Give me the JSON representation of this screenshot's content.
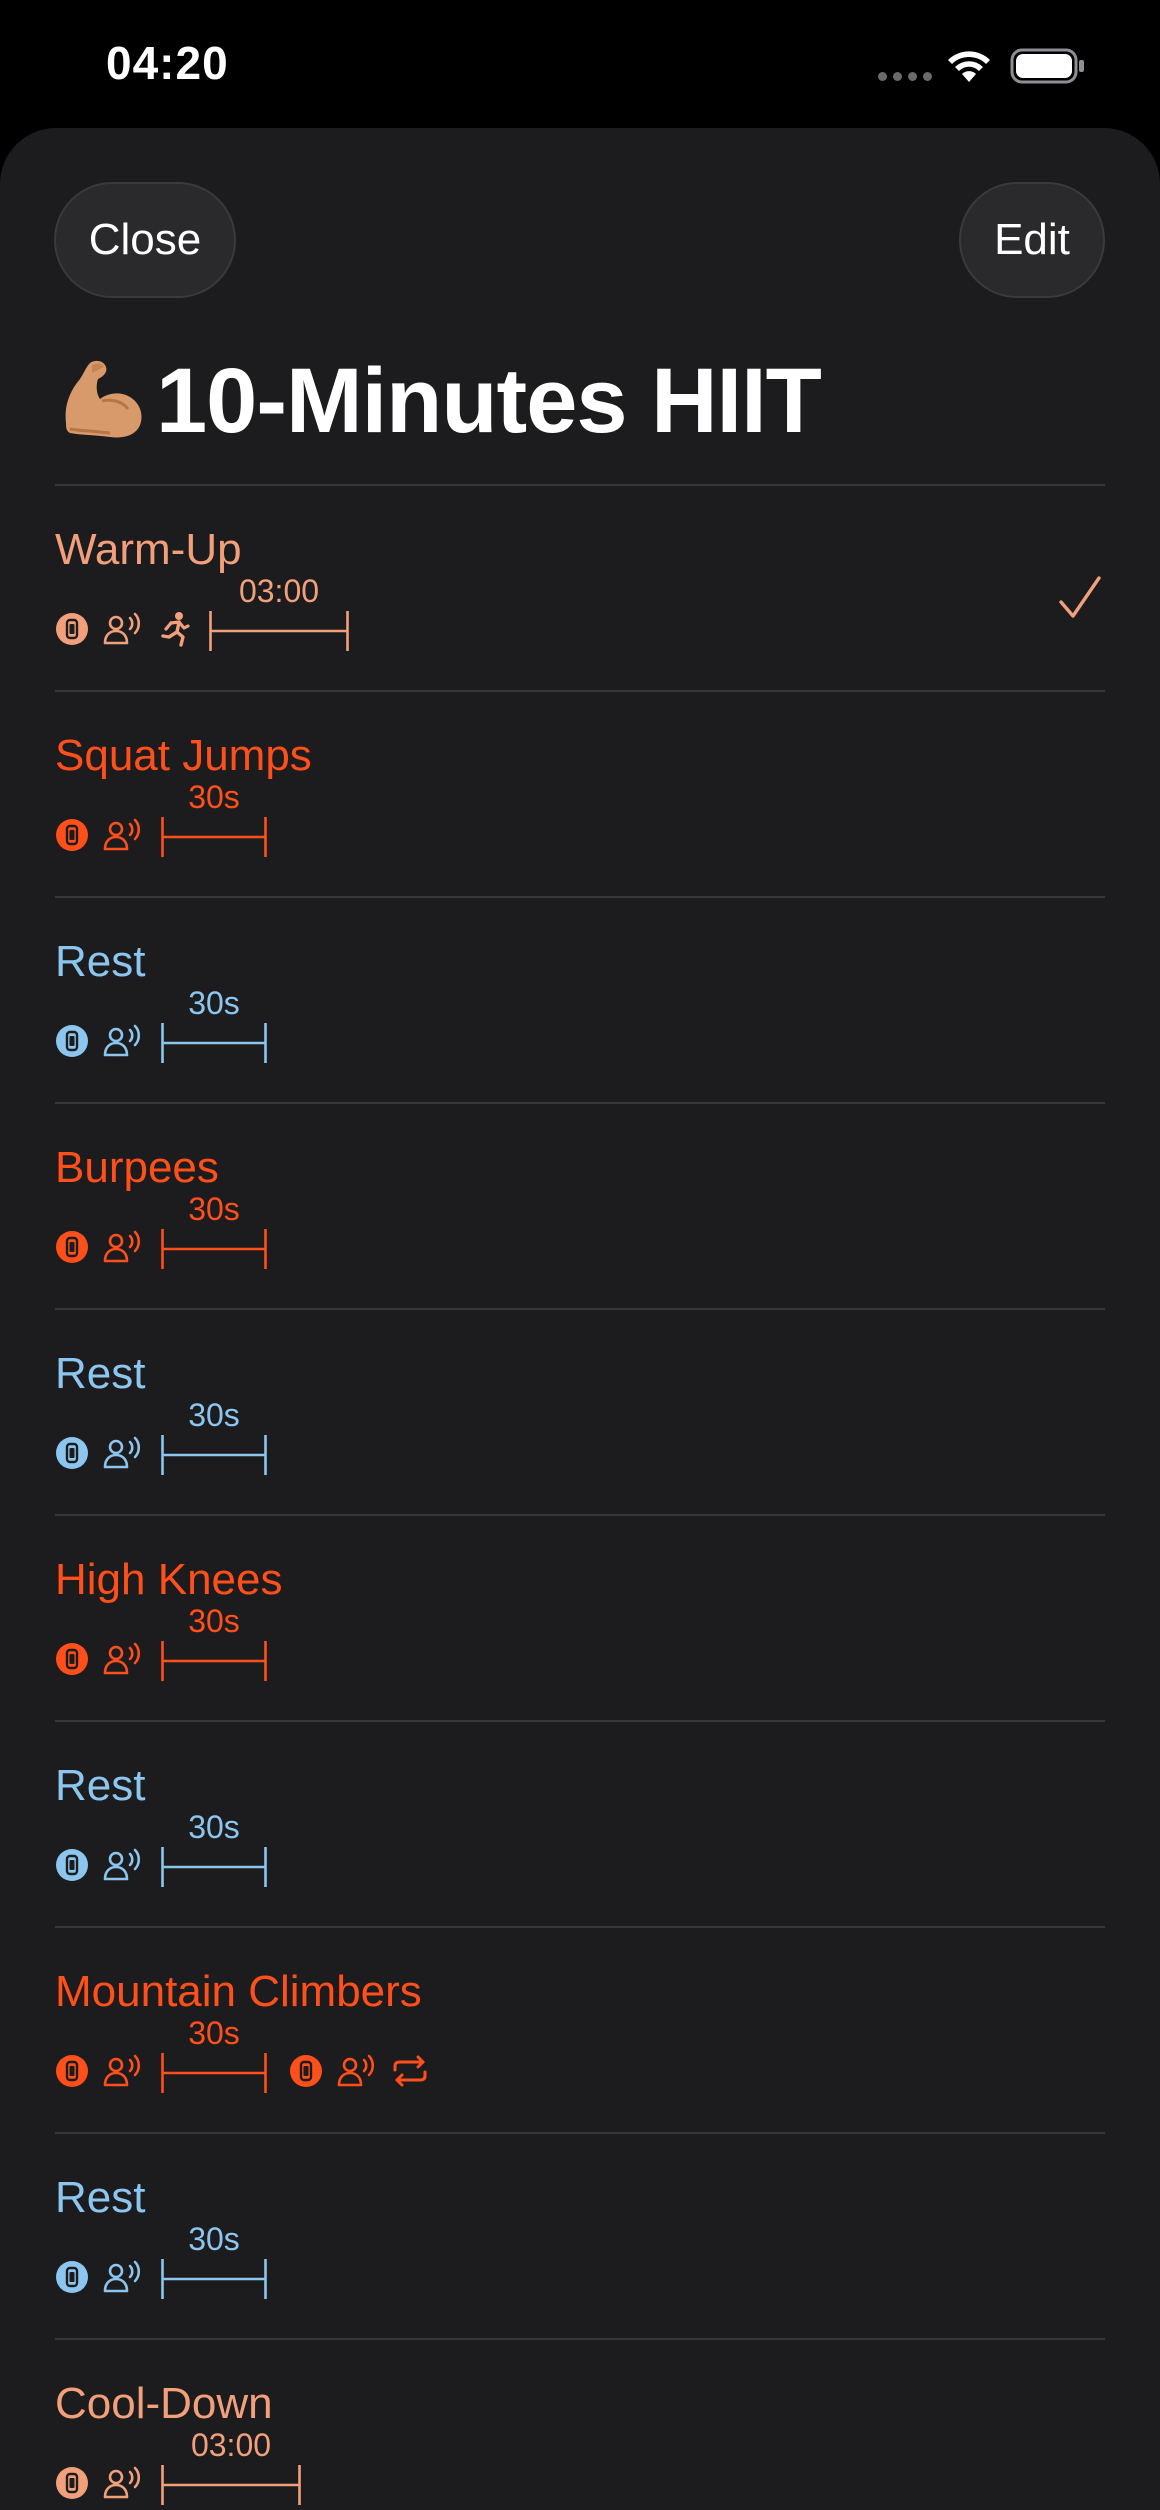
{
  "status_bar": {
    "time": "04:20"
  },
  "header": {
    "close_label": "Close",
    "edit_label": "Edit"
  },
  "workout": {
    "title": "10-Minutes HIIT",
    "title_icon": "flexed-biceps-emoji"
  },
  "colors": {
    "warm": "#f2a07b",
    "active": "#ff4f1a",
    "rest": "#8cc6ef",
    "sheet_bg": "#1c1c1e",
    "divider": "#38383a"
  },
  "intervals": [
    {
      "name": "Warm-Up",
      "duration": "03:00",
      "kind": "warm",
      "icons": [
        "watch-badge-icon",
        "voice-cue-icon",
        "running-figure-icon"
      ],
      "completed": true,
      "repeat": false
    },
    {
      "name": "Squat Jumps",
      "duration": "30s",
      "kind": "active",
      "icons": [
        "watch-badge-icon",
        "voice-cue-icon"
      ],
      "completed": false,
      "repeat": false
    },
    {
      "name": "Rest",
      "duration": "30s",
      "kind": "rest",
      "icons": [
        "watch-badge-icon",
        "voice-cue-icon"
      ],
      "completed": false,
      "repeat": false
    },
    {
      "name": "Burpees",
      "duration": "30s",
      "kind": "active",
      "icons": [
        "watch-badge-icon",
        "voice-cue-icon"
      ],
      "completed": false,
      "repeat": false
    },
    {
      "name": "Rest",
      "duration": "30s",
      "kind": "rest",
      "icons": [
        "watch-badge-icon",
        "voice-cue-icon"
      ],
      "completed": false,
      "repeat": false
    },
    {
      "name": "High Knees",
      "duration": "30s",
      "kind": "active",
      "icons": [
        "watch-badge-icon",
        "voice-cue-icon"
      ],
      "completed": false,
      "repeat": false
    },
    {
      "name": "Rest",
      "duration": "30s",
      "kind": "rest",
      "icons": [
        "watch-badge-icon",
        "voice-cue-icon"
      ],
      "completed": false,
      "repeat": false
    },
    {
      "name": "Mountain Climbers",
      "duration": "30s",
      "kind": "active",
      "icons": [
        "watch-badge-icon",
        "voice-cue-icon"
      ],
      "completed": false,
      "repeat": true
    },
    {
      "name": "Rest",
      "duration": "30s",
      "kind": "rest",
      "icons": [
        "watch-badge-icon",
        "voice-cue-icon"
      ],
      "completed": false,
      "repeat": false
    },
    {
      "name": "Cool-Down",
      "duration": "03:00",
      "kind": "warm",
      "icons": [
        "watch-badge-icon",
        "voice-cue-icon"
      ],
      "completed": false,
      "repeat": false
    }
  ]
}
